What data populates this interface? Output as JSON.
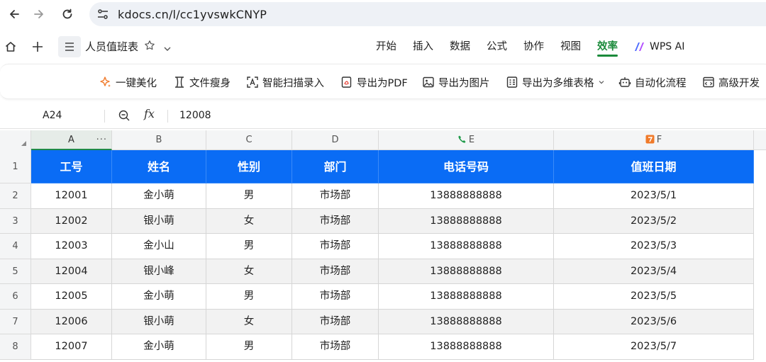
{
  "browser": {
    "url": "kdocs.cn/l/cc1yvswkCNYP",
    "icons": [
      "back-arrow-icon",
      "forward-arrow-icon",
      "reload-icon",
      "site-settings-icon"
    ]
  },
  "app_header": {
    "doc_title": "人员值班表",
    "tabs": [
      {
        "label": "开始",
        "active": false
      },
      {
        "label": "插入",
        "active": false
      },
      {
        "label": "数据",
        "active": false
      },
      {
        "label": "公式",
        "active": false
      },
      {
        "label": "协作",
        "active": false
      },
      {
        "label": "视图",
        "active": false
      },
      {
        "label": "效率",
        "active": true
      }
    ],
    "wps_ai_label": "WPS AI",
    "accent_color": "#1a8a3a"
  },
  "ribbon": {
    "items": [
      {
        "label": "一键美化",
        "icon": "sparkle-icon"
      },
      {
        "label": "文件瘦身",
        "icon": "file-slim-icon"
      },
      {
        "label": "智能扫描录入",
        "icon": "scan-icon"
      },
      {
        "label": "导出为PDF",
        "icon": "pdf-export-icon"
      },
      {
        "label": "导出为图片",
        "icon": "image-export-icon"
      },
      {
        "label": "导出为多维表格",
        "icon": "multi-table-icon"
      },
      {
        "label": "自动化流程",
        "icon": "robot-icon"
      },
      {
        "label": "高级开发",
        "icon": "dev-icon"
      }
    ]
  },
  "formula_bar": {
    "cell_ref": "A24",
    "fx_label": "fx",
    "value": "12008"
  },
  "sheet": {
    "column_letters": [
      "A",
      "B",
      "C",
      "D",
      "E",
      "F"
    ],
    "row_numbers": [
      "1",
      "2",
      "3",
      "4",
      "5",
      "6",
      "7",
      "8"
    ],
    "header_color": "#0a6cf5",
    "headers": [
      "工号",
      "姓名",
      "性别",
      "部门",
      "电话号码",
      "值班日期"
    ],
    "rows": [
      [
        "12001",
        "金小萌",
        "男",
        "市场部",
        "13888888888",
        "2023/5/1"
      ],
      [
        "12002",
        "银小萌",
        "女",
        "市场部",
        "13888888888",
        "2023/5/2"
      ],
      [
        "12003",
        "金小山",
        "男",
        "市场部",
        "13888888888",
        "2023/5/3"
      ],
      [
        "12004",
        "银小峰",
        "女",
        "市场部",
        "13888888888",
        "2023/5/4"
      ],
      [
        "12005",
        "金小萌",
        "男",
        "市场部",
        "13888888888",
        "2023/5/5"
      ],
      [
        "12006",
        "银小萌",
        "女",
        "市场部",
        "13888888888",
        "2023/5/6"
      ],
      [
        "12007",
        "金小萌",
        "男",
        "市场部",
        "13888888888",
        "2023/5/7"
      ]
    ]
  }
}
